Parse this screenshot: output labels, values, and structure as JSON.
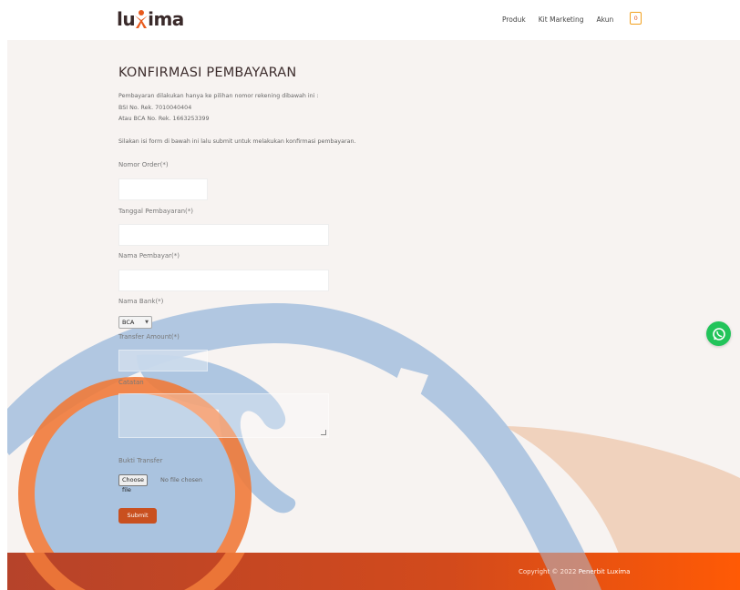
{
  "header": {
    "logo_text_left": "lu",
    "logo_text_right": "ima",
    "nav": [
      {
        "label": "Produk"
      },
      {
        "label": "Kit Marketing"
      },
      {
        "label": "Akun"
      }
    ],
    "cart_count": "0"
  },
  "form": {
    "title": "KONFIRMASI PEMBAYARAN",
    "intro_lines": [
      "Pembayaran dilakukan hanya ke pilihan nomor rekening dibawah ini :",
      "BSI No. Rek. 7010040404",
      "Atau BCA No. Rek. 1663253399",
      "",
      "Silakan isi form di bawah ini lalu submit untuk melakukan konfirmasi pembayaran."
    ],
    "order_label": "Nomor Order(*)",
    "order_value": "",
    "date_label": "Tanggal Pembayaran(*)",
    "date_value": "",
    "payer_label": "Nama Pembayar(*)",
    "payer_value": "",
    "bank_label": "Nama Bank(*)",
    "bank_selected": "BCA",
    "amount_label": "Transfer Amount(*)",
    "amount_value": "",
    "notes_label": "Catatan",
    "notes_value": "",
    "proof_label": "Bukti Transfer",
    "choose_file_label": "Choose file",
    "no_file_label": "No file chosen",
    "submit_label": "Submit"
  },
  "footer": {
    "copyright_prefix": "Copyright © 2022 ",
    "copyright_brand": "Penerbit Luxima"
  },
  "colors": {
    "accent": "#c9501f",
    "footer_end": "#ff5a05",
    "whatsapp": "#22c45a",
    "watermark_blue": "#a9c2e0"
  },
  "icons": {
    "cart": "cart-icon",
    "whatsapp": "whatsapp-icon",
    "select_caret": "caret-down-icon"
  }
}
